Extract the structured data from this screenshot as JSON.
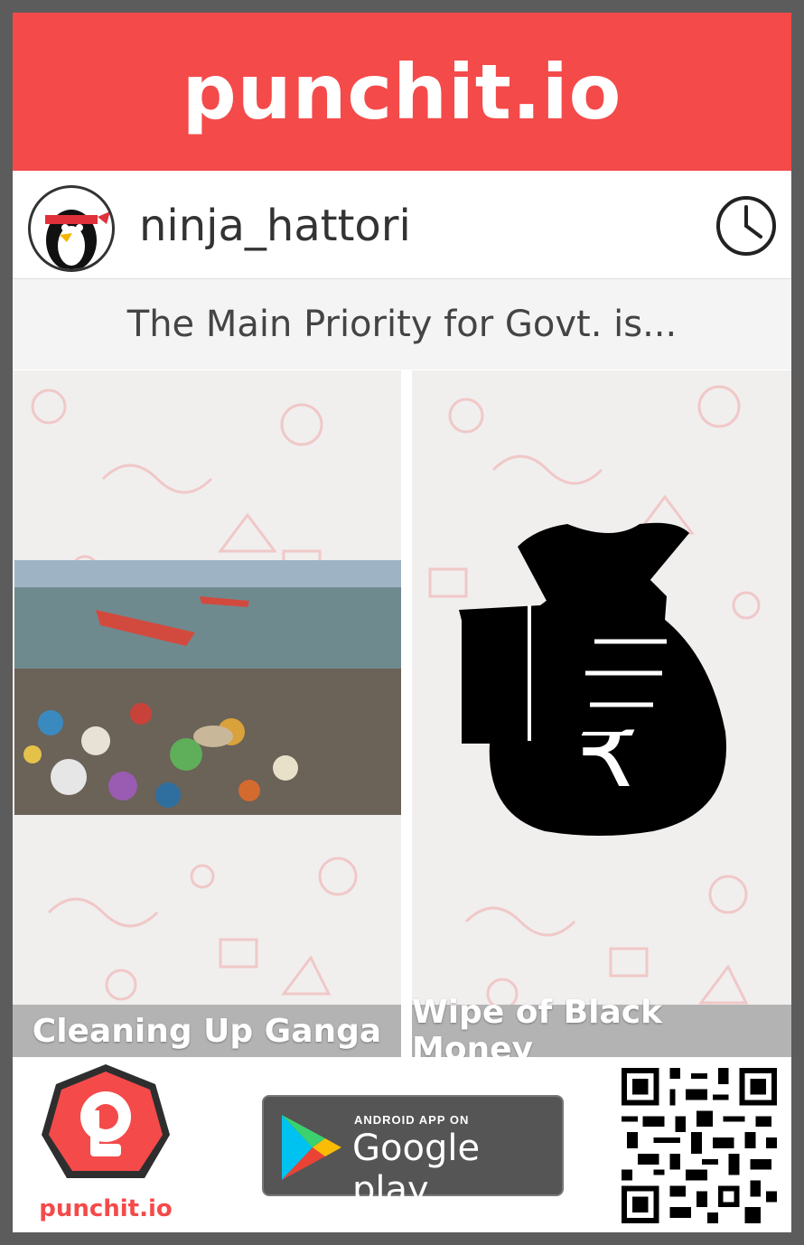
{
  "app": {
    "brand": "punchit.io",
    "brand_color": "#f44a4a"
  },
  "user": {
    "username": "ninja_hattori",
    "avatar_icon": "ninja-penguin-avatar",
    "clock_icon": "clock-icon"
  },
  "poll": {
    "question": "The Main Priority for Govt. is...",
    "options": [
      {
        "label": "Cleaning Up Ganga",
        "image": "polluted-river-photo"
      },
      {
        "label": "Wipe of Black Money",
        "image": "hand-holding-rupee-money-bag-icon"
      }
    ]
  },
  "footer": {
    "logo_text": "punchit.io",
    "store_small": "ANDROID APP ON",
    "store_big": "Google play",
    "qr": "qr-code"
  }
}
